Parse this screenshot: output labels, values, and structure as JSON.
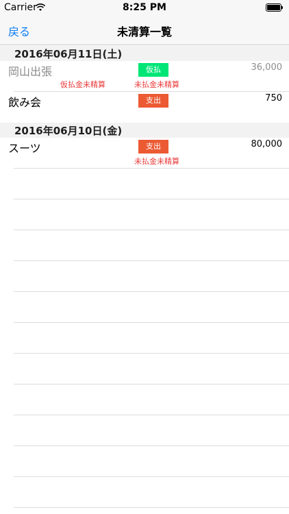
{
  "status_bar": {
    "carrier": "Carrier",
    "time": "8:25 PM"
  },
  "nav": {
    "back_label": "戻る",
    "title": "未清算一覧"
  },
  "sections": [
    {
      "date": "2016年06月11日(土)",
      "items": [
        {
          "title": "岡山出張",
          "tag": "仮払",
          "amount": "36,000",
          "status_left": "仮払金未精算",
          "status_center": "未払金未精算"
        },
        {
          "title": "飲み会",
          "tag": "支出",
          "amount": "750"
        }
      ]
    },
    {
      "date": "2016年06月10日(金)",
      "items": [
        {
          "title": "スーツ",
          "tag": "支出",
          "amount": "80,000",
          "status_center": "未払金未精算"
        }
      ]
    }
  ],
  "colors": {
    "accent": "#0a7bf6",
    "tag_advance": "#00e676",
    "tag_expense": "#ec5a33",
    "warning_text": "#ea3a3a"
  }
}
